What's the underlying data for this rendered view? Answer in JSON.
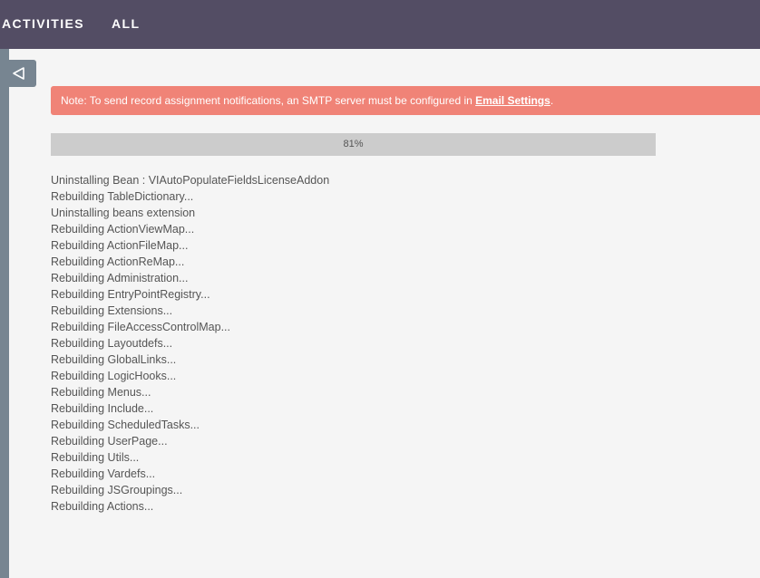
{
  "nav": {
    "activities_label": "ACTIVITIES",
    "all_label": "ALL"
  },
  "sidebar": {
    "toggle_icon": "collapse-left-triangle-icon"
  },
  "alert": {
    "text": "Note: To send record assignment notifications, an SMTP server must be configured in ",
    "link_text": "Email Settings",
    "suffix": "."
  },
  "progress": {
    "percent": 81,
    "label": "81%"
  },
  "log": {
    "lines": [
      "Uninstalling Bean : VIAutoPopulateFieldsLicenseAddon",
      "Rebuilding TableDictionary...",
      "Uninstalling beans extension",
      "Rebuilding ActionViewMap...",
      "Rebuilding ActionFileMap...",
      "Rebuilding ActionReMap...",
      "Rebuilding Administration...",
      "Rebuilding EntryPointRegistry...",
      "Rebuilding Extensions...",
      "Rebuilding FileAccessControlMap...",
      "Rebuilding Layoutdefs...",
      "Rebuilding GlobalLinks...",
      "Rebuilding LogicHooks...",
      "Rebuilding Menus...",
      "Rebuilding Include...",
      "Rebuilding ScheduledTasks...",
      "Rebuilding UserPage...",
      "Rebuilding Utils...",
      "Rebuilding Vardefs...",
      "Rebuilding JSGroupings...",
      "Rebuilding Actions..."
    ]
  },
  "colors": {
    "topbar": "#534d64",
    "sidebar": "#778591",
    "alert": "#f08377",
    "progress_track": "#cccccc"
  }
}
